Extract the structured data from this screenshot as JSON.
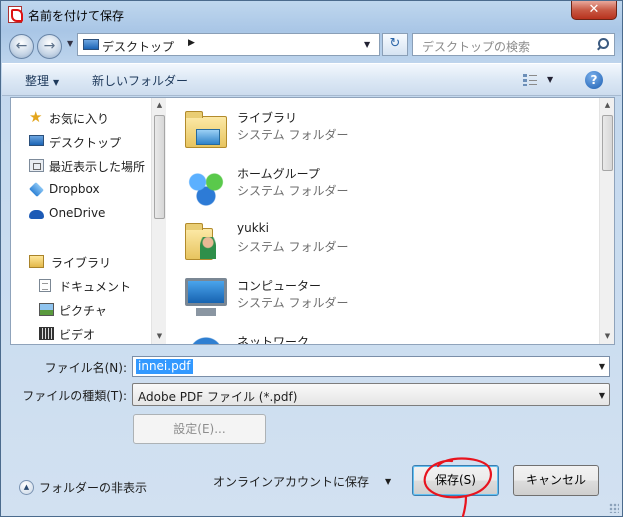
{
  "window": {
    "title": "名前を付けて保存"
  },
  "address": {
    "path": "デスクトップ",
    "search_placeholder": "デスクトップの検索"
  },
  "toolbar": {
    "organize": "整理",
    "new_folder": "新しいフォルダー",
    "help": "?"
  },
  "nav": {
    "items": [
      {
        "label": "お気に入り",
        "icon": "star-icon"
      },
      {
        "label": "デスクトップ",
        "icon": "desktop-icon"
      },
      {
        "label": "最近表示した場所",
        "icon": "recent-places-icon"
      },
      {
        "label": "Dropbox",
        "icon": "dropbox-icon"
      },
      {
        "label": "OneDrive",
        "icon": "onedrive-icon"
      },
      {
        "label": "ライブラリ",
        "icon": "library-icon"
      },
      {
        "label": "ドキュメント",
        "icon": "documents-icon"
      },
      {
        "label": "ピクチャ",
        "icon": "pictures-icon"
      },
      {
        "label": "ビデオ",
        "icon": "videos-icon"
      }
    ]
  },
  "files": [
    {
      "name": "ライブラリ",
      "type": "システム フォルダー",
      "icon": "library-folder-icon"
    },
    {
      "name": "ホームグループ",
      "type": "システム フォルダー",
      "icon": "homegroup-icon"
    },
    {
      "name": "yukki",
      "type": "システム フォルダー",
      "icon": "user-folder-icon"
    },
    {
      "name": "コンピューター",
      "type": "システム フォルダー",
      "icon": "computer-icon"
    },
    {
      "name": "ネットワーク",
      "type": "",
      "icon": "network-icon"
    }
  ],
  "form": {
    "filename_label": "ファイル名(N):",
    "filename_value": "innei.pdf",
    "filetype_label": "ファイルの種類(T):",
    "filetype_value": "Adobe PDF ファイル (*.pdf)",
    "settings_button": "設定(E)..."
  },
  "footer": {
    "hide_folders": "フォルダーの非表示",
    "online_save": "オンラインアカウントに保存",
    "save_button": "保存(S)",
    "cancel_button": "キャンセル"
  },
  "colors": {
    "selection": "#3399ff",
    "annotation_red": "#e8141e",
    "close_button": "#c85a45"
  }
}
